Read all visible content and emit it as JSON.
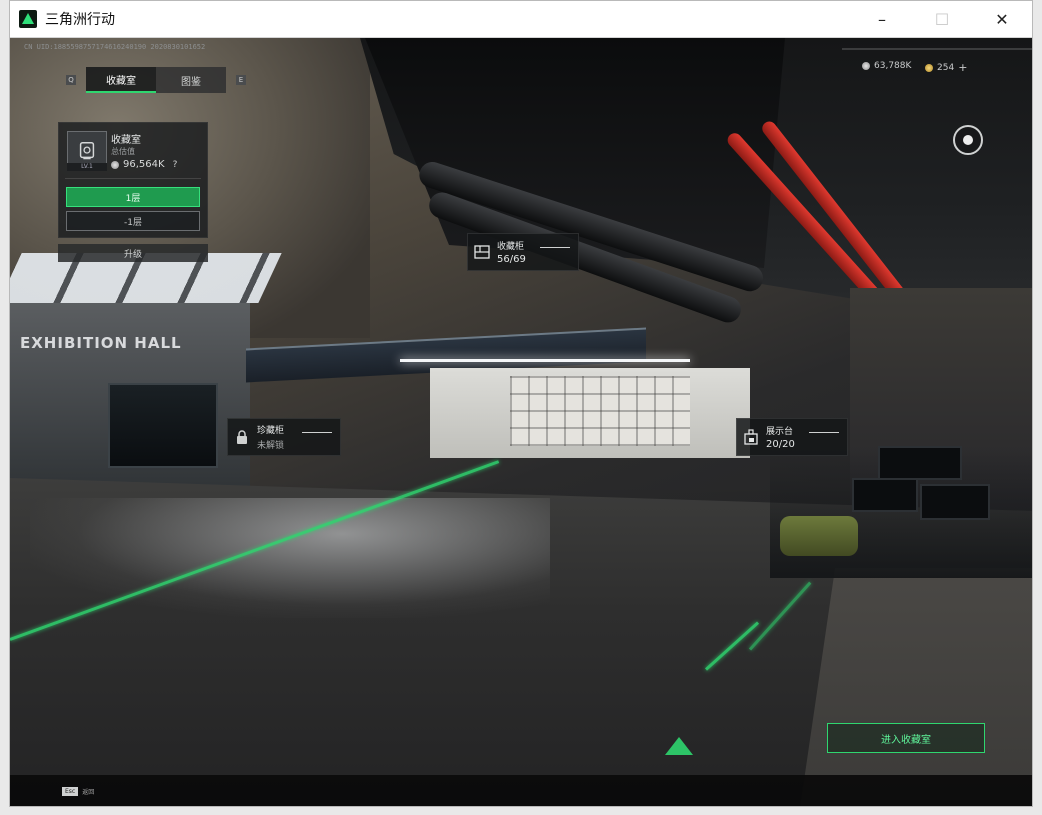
{
  "window": {
    "title": "三角洲行动",
    "controls": {
      "minimize": "–",
      "maximize": "☐",
      "close": "✕"
    }
  },
  "hud": {
    "uid": "CN UID:1885598757174616240190 2020830101652",
    "currency_silver": "63,788K",
    "currency_gold": "254",
    "currency_plus": "+"
  },
  "tabs": [
    {
      "label": "收藏室",
      "active": true
    },
    {
      "label": "图鉴",
      "active": false
    }
  ],
  "tab_arrows": {
    "left": "Q",
    "right": "E"
  },
  "panel": {
    "title": "收藏室",
    "level": "LV.1",
    "value_label": "总估值",
    "value": "96,564K",
    "help": "?",
    "floor_active": "1层",
    "floor_other": "-1层",
    "upgrade": "升级"
  },
  "labels": {
    "cabinet": {
      "name": "收藏柜",
      "count": "56/69"
    },
    "treasure": {
      "name": "珍藏柜",
      "status": "未解锁"
    },
    "display": {
      "name": "展示台",
      "count": "20/20"
    }
  },
  "scene": {
    "hall_text": "EXHIBITION HALL"
  },
  "actions": {
    "enter": "进入收藏室"
  },
  "footer": {
    "esc_key": "Esc",
    "esc_label": "返回"
  },
  "colors": {
    "accent": "#2fd66f",
    "red_pipe": "#e0392f"
  },
  "icons": {
    "panel": "trophy-icon",
    "cabinet": "cabinet-icon",
    "treasure": "lock-icon",
    "display": "display-icon",
    "compass": "compass-icon"
  }
}
